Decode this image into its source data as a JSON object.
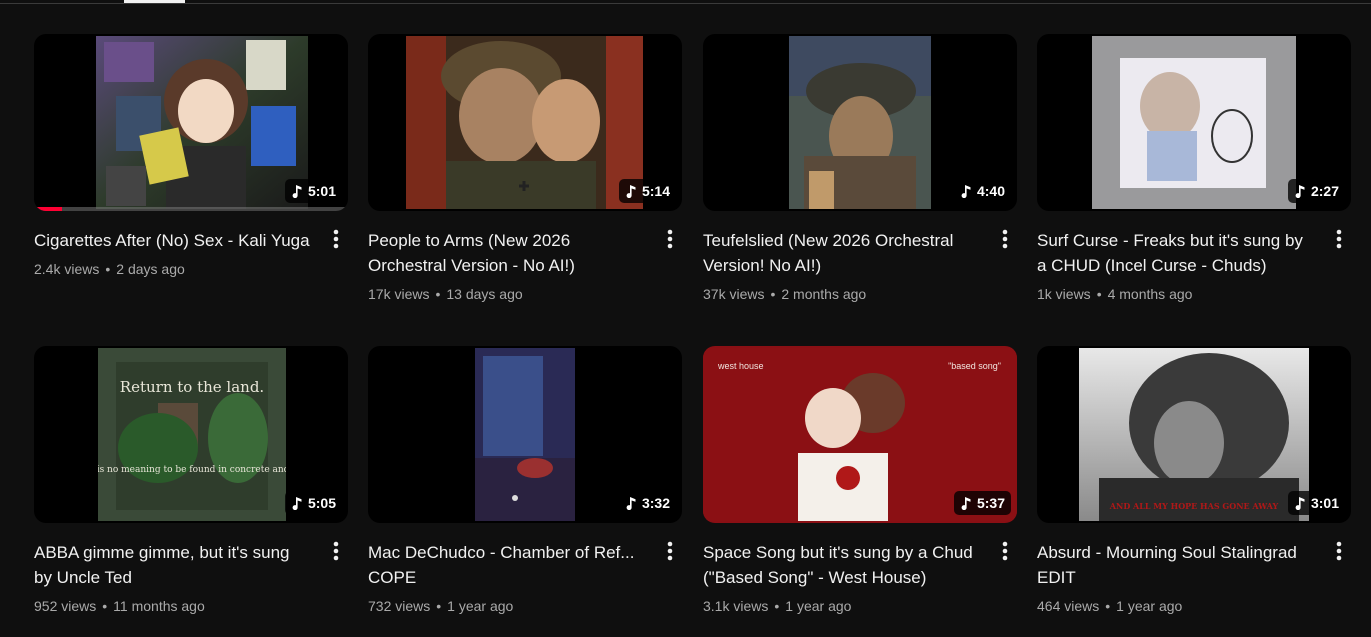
{
  "videos": [
    {
      "title": "Cigarettes After (No) Sex - Kali Yuga",
      "views": "2.4k views",
      "age": "2 days ago",
      "duration": "5:01",
      "progress": 0.09
    },
    {
      "title": "People to Arms (New 2026\nOrchestral Version - No AI!)",
      "views": "17k views",
      "age": "13 days ago",
      "duration": "5:14"
    },
    {
      "title": "Teufelslied (New 2026 Orchestral\nVersion! No AI!)",
      "views": "37k views",
      "age": "2 months ago",
      "duration": "4:40"
    },
    {
      "title": "Surf Curse - Freaks but it's sung by\na CHUD (Incel Curse - Chuds)",
      "views": "1k views",
      "age": "4 months ago",
      "duration": "2:27"
    },
    {
      "title": "ABBA gimme gimme, but it's sung\nby Uncle Ted",
      "views": "952 views",
      "age": "11 months ago",
      "duration": "5:05",
      "thumb_text_top": "Return to the land.",
      "thumb_text_bottom": "There is no meaning to be found in concrete and steel."
    },
    {
      "title": "Mac DeChudco - Chamber of Ref...\nCOPE",
      "views": "732 views",
      "age": "1 year ago",
      "duration": "3:32"
    },
    {
      "title": "Space Song but it's sung by a Chud\n(\"Based Song\" - West House)",
      "views": "3.1k views",
      "age": "1 year ago",
      "duration": "5:37",
      "thumb_text_left": "west house",
      "thumb_text_right": "\"based song\""
    },
    {
      "title": "Absurd - Mourning Soul Stalingrad\nEDIT",
      "views": "464 views",
      "age": "1 year ago",
      "duration": "3:01",
      "thumb_text_bottom": "AND ALL MY HOPE HAS GONE AWAY"
    }
  ],
  "icons": {
    "duration": "music-note-icon",
    "menu": "more-vert-icon"
  },
  "colors": {
    "background": "#0f0f0f",
    "text": "#f1f1f1",
    "meta": "#aaaaaa",
    "progress": "#ff0033"
  }
}
